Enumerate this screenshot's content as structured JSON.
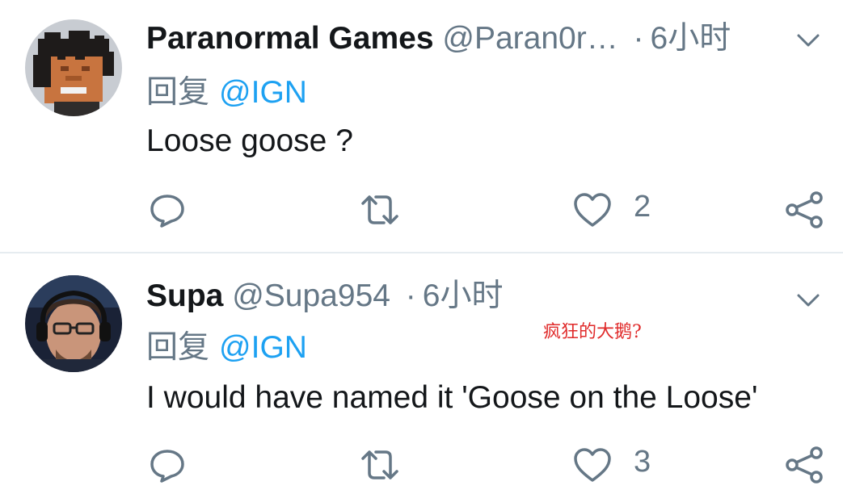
{
  "tweets": [
    {
      "name": "Paranormal Games",
      "handle": "@Paran0r…",
      "separator": "·",
      "time": "6小时",
      "reply_prefix": "回复",
      "mention": "@IGN",
      "text": "Loose goose ?",
      "likes": "2"
    },
    {
      "name": "Supa",
      "handle": "@Supa954",
      "separator": "·",
      "time": "6小时",
      "reply_prefix": "回复",
      "mention": "@IGN",
      "text": "I would have named it 'Goose on the Loose'",
      "likes": "3"
    }
  ],
  "annotation": "疯狂的大鹅?",
  "icons": {
    "reply": "reply-icon",
    "retweet": "retweet-icon",
    "like": "heart-icon",
    "share": "share-icon",
    "more": "chevron-down-icon"
  },
  "colors": {
    "text": "#14171a",
    "secondary": "#657786",
    "link": "#1da1f2",
    "divider": "#e6ecf0",
    "annotation": "#e02a2a"
  }
}
